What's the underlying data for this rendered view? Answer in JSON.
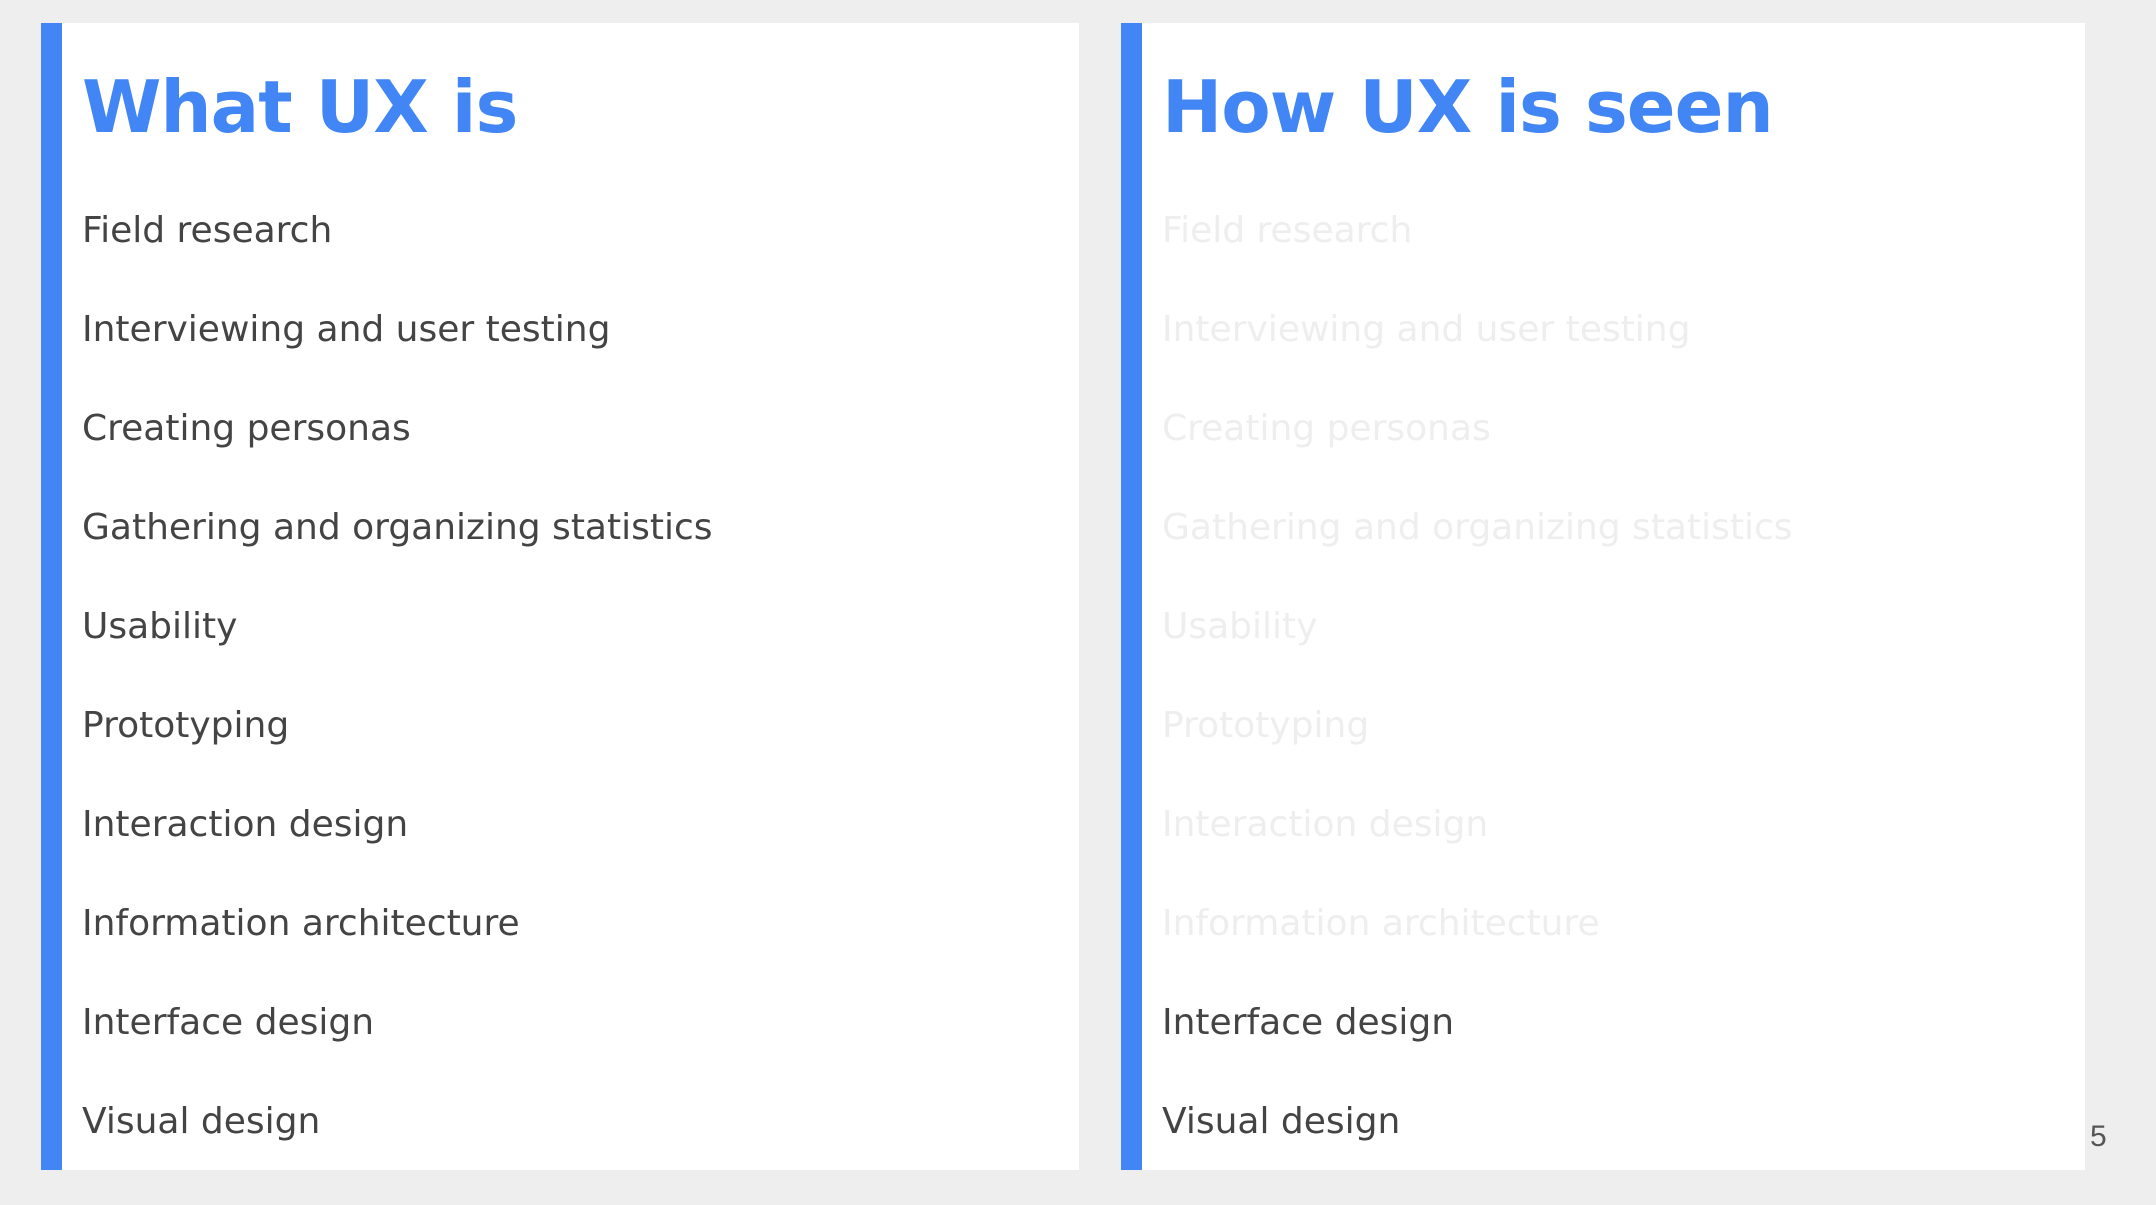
{
  "colors": {
    "accent": "#4285f4",
    "text": "#444444",
    "faded_text": "#eeeeee",
    "panel": "#ffffff",
    "background": "#eeeeee"
  },
  "left_panel": {
    "title": "What UX is",
    "items": [
      {
        "label": "Field research",
        "faded": false
      },
      {
        "label": "Interviewing and user testing",
        "faded": false
      },
      {
        "label": "Creating personas",
        "faded": false
      },
      {
        "label": "Gathering and organizing statistics",
        "faded": false
      },
      {
        "label": "Usability",
        "faded": false
      },
      {
        "label": "Prototyping",
        "faded": false
      },
      {
        "label": "Interaction design",
        "faded": false
      },
      {
        "label": "Information architecture",
        "faded": false
      },
      {
        "label": "Interface design",
        "faded": false
      },
      {
        "label": "Visual design",
        "faded": false
      }
    ]
  },
  "right_panel": {
    "title": "How UX is seen",
    "items": [
      {
        "label": "Field research",
        "faded": true
      },
      {
        "label": "Interviewing and user testing",
        "faded": true
      },
      {
        "label": "Creating personas",
        "faded": true
      },
      {
        "label": "Gathering and organizing statistics",
        "faded": true
      },
      {
        "label": "Usability",
        "faded": true
      },
      {
        "label": "Prototyping",
        "faded": true
      },
      {
        "label": "Interaction design",
        "faded": true
      },
      {
        "label": "Information architecture",
        "faded": true
      },
      {
        "label": "Interface design",
        "faded": false
      },
      {
        "label": "Visual design",
        "faded": false
      }
    ]
  },
  "page_number": "5"
}
